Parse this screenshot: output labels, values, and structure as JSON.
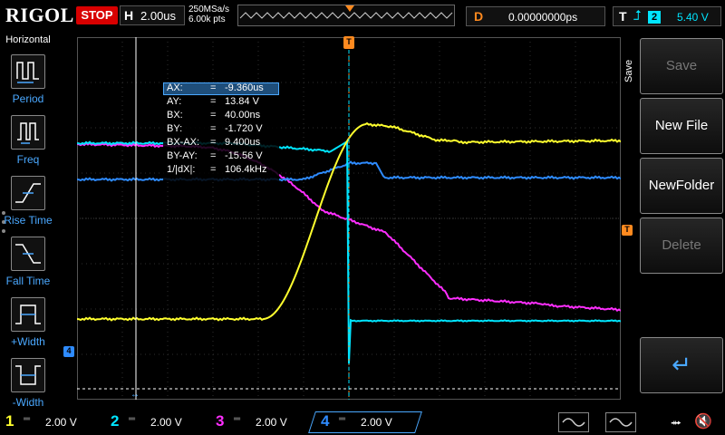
{
  "top": {
    "logo": "RIGOL",
    "run_state": "STOP",
    "timebase_label": "H",
    "timebase_value": "2.00us",
    "sample_rate": "250MSa/s",
    "memory_depth": "6.00k pts",
    "delay_label": "D",
    "delay_value": "0.00000000ps",
    "trigger_label": "T",
    "trigger_source": "2",
    "trigger_level": "5.40 V"
  },
  "left_menu": {
    "title": "Horizontal",
    "items": [
      {
        "label": "Period",
        "icon": "period-icon"
      },
      {
        "label": "Freq",
        "icon": "freq-icon"
      },
      {
        "label": "Rise Time",
        "icon": "rise-time-icon"
      },
      {
        "label": "Fall Time",
        "icon": "fall-time-icon"
      },
      {
        "label": "+Width",
        "icon": "positive-width-icon"
      },
      {
        "label": "-Width",
        "icon": "negative-width-icon"
      }
    ]
  },
  "cursor_readout": [
    {
      "key": "AX:",
      "value": "-9.360us"
    },
    {
      "key": "AY:",
      "value": "13.84 V"
    },
    {
      "key": "BX:",
      "value": "40.00ns"
    },
    {
      "key": "BY:",
      "value": "-1.720 V"
    },
    {
      "key": "BX-AX:",
      "value": "9.400us"
    },
    {
      "key": "BY-AY:",
      "value": "-15.56 V"
    },
    {
      "key": "1/|dX|:",
      "value": "106.4kHz"
    }
  ],
  "right_menu": {
    "title": "Save",
    "buttons": [
      {
        "label": "Save",
        "enabled": false
      },
      {
        "label": "New File",
        "enabled": true
      },
      {
        "label": "NewFolder",
        "enabled": true
      },
      {
        "label": "Delete",
        "enabled": false
      },
      {
        "label": "↵",
        "enabled": true
      }
    ]
  },
  "channels": [
    {
      "num": "1",
      "coupling": "DC",
      "vdiv": "2.00 V",
      "color": "#ffff2e"
    },
    {
      "num": "2",
      "coupling": "DC",
      "vdiv": "2.00 V",
      "color": "#00e5ff"
    },
    {
      "num": "3",
      "coupling": "DC",
      "vdiv": "2.00 V",
      "color": "#ff2eff"
    },
    {
      "num": "4",
      "coupling": "DC",
      "vdiv": "2.00 V",
      "color": "#2e8bff"
    }
  ],
  "markers": {
    "ch4_label": "4",
    "trigger_pos": "T",
    "trigger_level": "T"
  },
  "colors": {
    "ch1": "#ffff2e",
    "ch2": "#00e5ff",
    "ch3": "#ff2eff",
    "ch4": "#2e8bff",
    "accent": "#4aa8ff",
    "trigger": "#ff8a1f",
    "stop": "#d80000"
  }
}
